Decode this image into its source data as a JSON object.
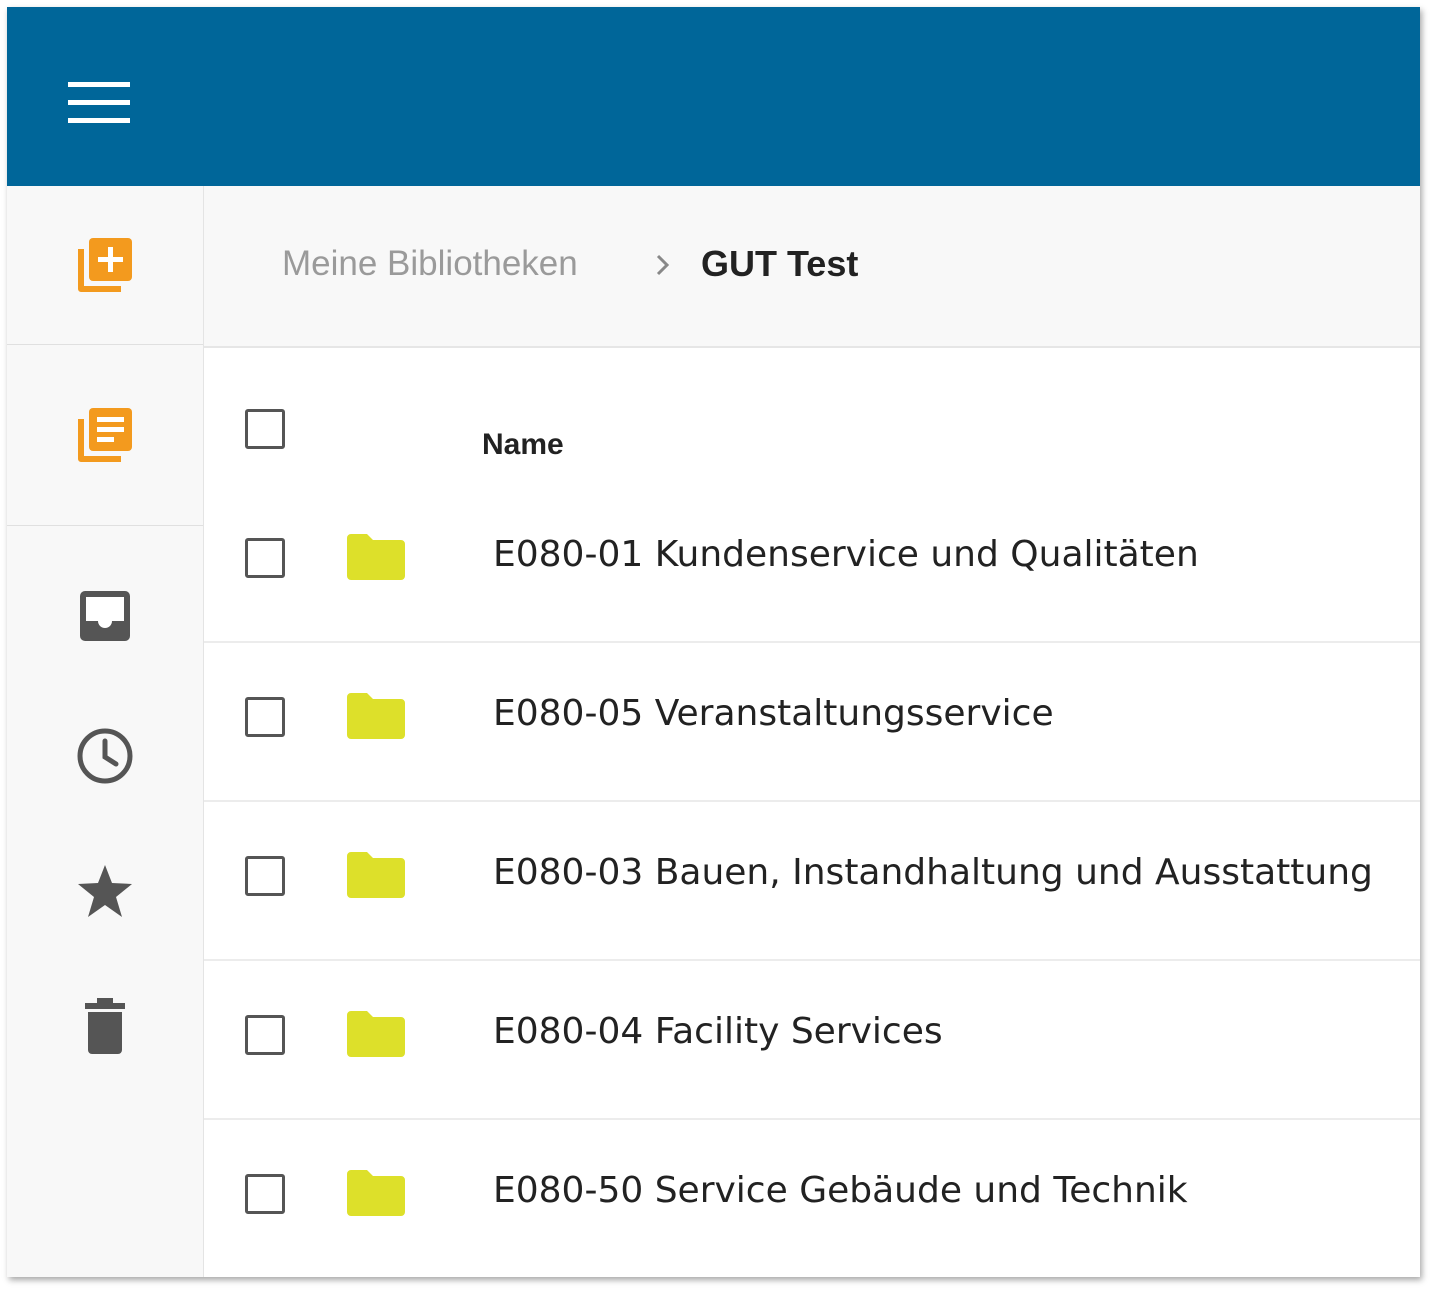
{
  "header": {
    "menu_icon": "hamburger-menu-icon",
    "bg_color": "#006699"
  },
  "sidebar": {
    "items": [
      {
        "name": "create-library",
        "icon": "library-add-icon",
        "color": "#f39a1e"
      },
      {
        "name": "my-libraries",
        "icon": "library-books-icon",
        "color": "#f39a1e"
      },
      {
        "name": "inbox",
        "icon": "inbox-icon",
        "color": "#555555"
      },
      {
        "name": "recent",
        "icon": "clock-icon",
        "color": "#555555"
      },
      {
        "name": "favorites",
        "icon": "star-icon",
        "color": "#555555"
      },
      {
        "name": "trash",
        "icon": "trash-icon",
        "color": "#555555"
      }
    ]
  },
  "breadcrumb": {
    "parent": "Meine Bibliotheken",
    "current": "GUT Test"
  },
  "table": {
    "columns": {
      "name": "Name"
    },
    "folder_color": "#dde02a",
    "rows": [
      {
        "label": "E080-01 Kundenservice und Qualitäten"
      },
      {
        "label": "E080-05 Veranstaltungsservice"
      },
      {
        "label": "E080-03 Bauen, Instandhaltung und Ausstattung"
      },
      {
        "label": "E080-04 Facility Services"
      },
      {
        "label": "E080-50 Service Gebäude und Technik"
      }
    ]
  }
}
